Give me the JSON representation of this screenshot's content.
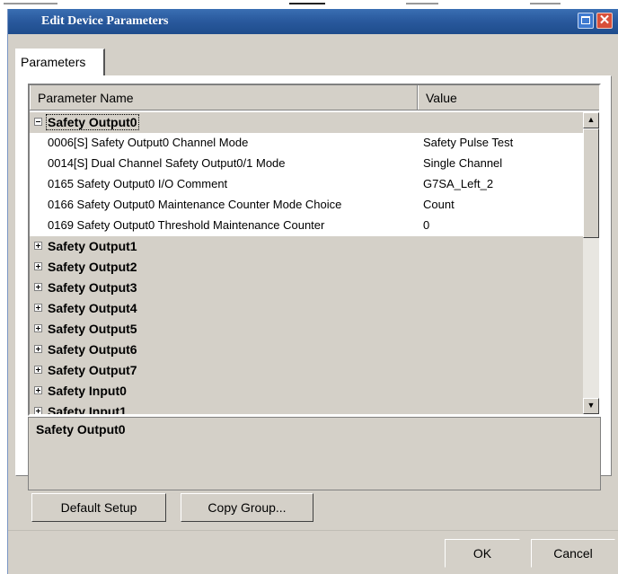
{
  "window": {
    "title": "Edit Device Parameters",
    "maximize_glyph": "",
    "close_glyph": "✕"
  },
  "tabs": [
    {
      "label": "Parameters",
      "active": true
    }
  ],
  "grid": {
    "columns": [
      "Parameter Name",
      "Value"
    ],
    "groups": [
      {
        "name": "Safety Output0",
        "expanded": true,
        "params": [
          {
            "name": "0006[S] Safety Output0 Channel Mode",
            "value": "Safety Pulse Test"
          },
          {
            "name": "0014[S] Dual Channel Safety Output0/1 Mode",
            "value": "Single Channel"
          },
          {
            "name": "0165 Safety Output0 I/O Comment",
            "value": "G7SA_Left_2"
          },
          {
            "name": "0166 Safety Output0 Maintenance Counter Mode Choice",
            "value": "Count"
          },
          {
            "name": "0169 Safety Output0 Threshold Maintenance Counter",
            "value": "0"
          }
        ]
      },
      {
        "name": "Safety Output1",
        "expanded": false
      },
      {
        "name": "Safety Output2",
        "expanded": false
      },
      {
        "name": "Safety Output3",
        "expanded": false
      },
      {
        "name": "Safety Output4",
        "expanded": false
      },
      {
        "name": "Safety Output5",
        "expanded": false
      },
      {
        "name": "Safety Output6",
        "expanded": false
      },
      {
        "name": "Safety Output7",
        "expanded": false
      },
      {
        "name": "Safety Input0",
        "expanded": false
      },
      {
        "name": "Safety Input1",
        "expanded": false
      }
    ]
  },
  "scrollbar": {
    "up_glyph": "▲",
    "down_glyph": "▼",
    "position_fraction": 0.0
  },
  "description": {
    "text": "Safety Output0"
  },
  "buttons": {
    "default_setup": "Default Setup",
    "copy_group": "Copy Group...",
    "ok": "OK",
    "cancel": "Cancel"
  },
  "colors": {
    "titlebar": "#2a5a9e",
    "dialog_face": "#d4d0c8",
    "close_button": "#d8503a"
  }
}
